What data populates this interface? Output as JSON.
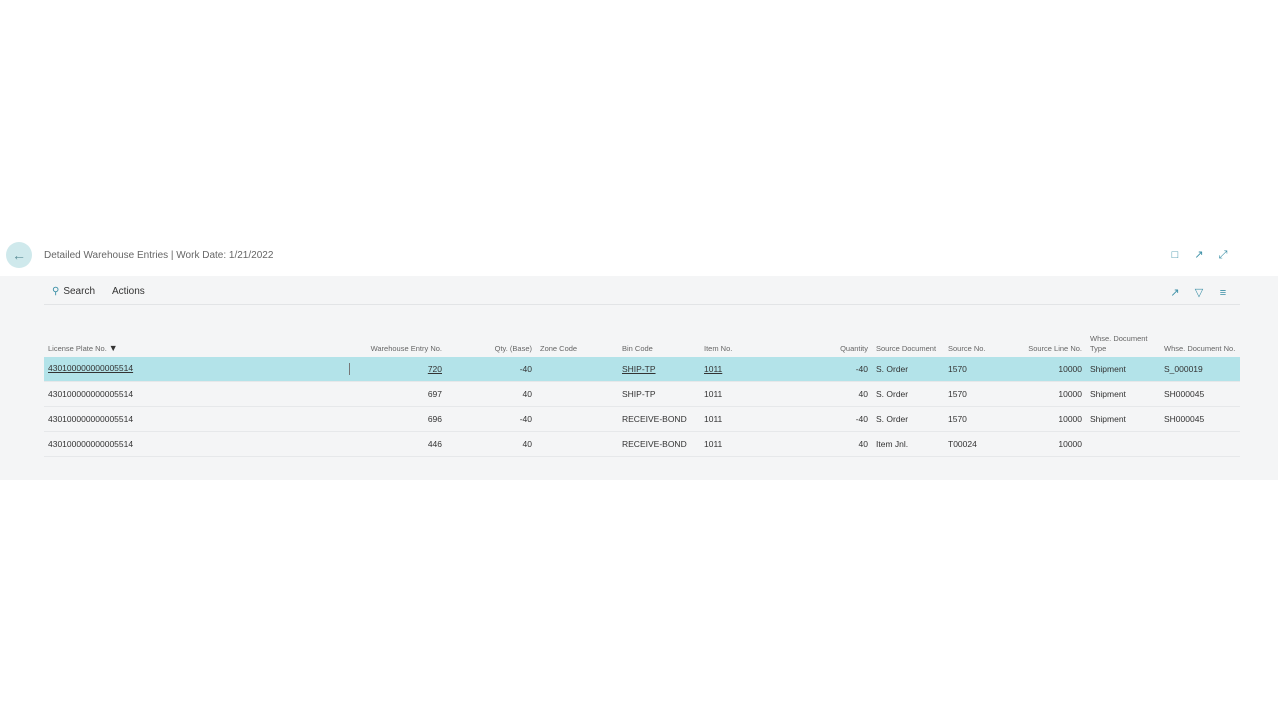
{
  "header": {
    "title": "Detailed Warehouse Entries | Work Date: 1/21/2022"
  },
  "toolbar": {
    "search_label": "Search",
    "actions_label": "Actions"
  },
  "table": {
    "columns": [
      "License Plate No.",
      "Warehouse Entry No.",
      "Qty. (Base)",
      "Zone Code",
      "Bin Code",
      "Item No.",
      "Quantity",
      "Source Document",
      "Source No.",
      "Source Line No.",
      "Whse. Document Type",
      "Whse. Document No."
    ],
    "rows": [
      [
        "430100000000005514",
        "720",
        "-40",
        "",
        "SHIP-TP",
        "1011",
        "-40",
        "S. Order",
        "1570",
        "10000",
        "Shipment",
        "S_000019"
      ],
      [
        "430100000000005514",
        "697",
        "40",
        "",
        "SHIP-TP",
        "1011",
        "40",
        "S. Order",
        "1570",
        "10000",
        "Shipment",
        "SH000045"
      ],
      [
        "430100000000005514",
        "696",
        "-40",
        "",
        "RECEIVE-BOND",
        "1011",
        "-40",
        "S. Order",
        "1570",
        "10000",
        "Shipment",
        "SH000045"
      ],
      [
        "430100000000005514",
        "446",
        "40",
        "",
        "RECEIVE-BOND",
        "1011",
        "40",
        "Item Jnl.",
        "T00024",
        "10000",
        "",
        ""
      ]
    ],
    "selected_row": 0
  }
}
